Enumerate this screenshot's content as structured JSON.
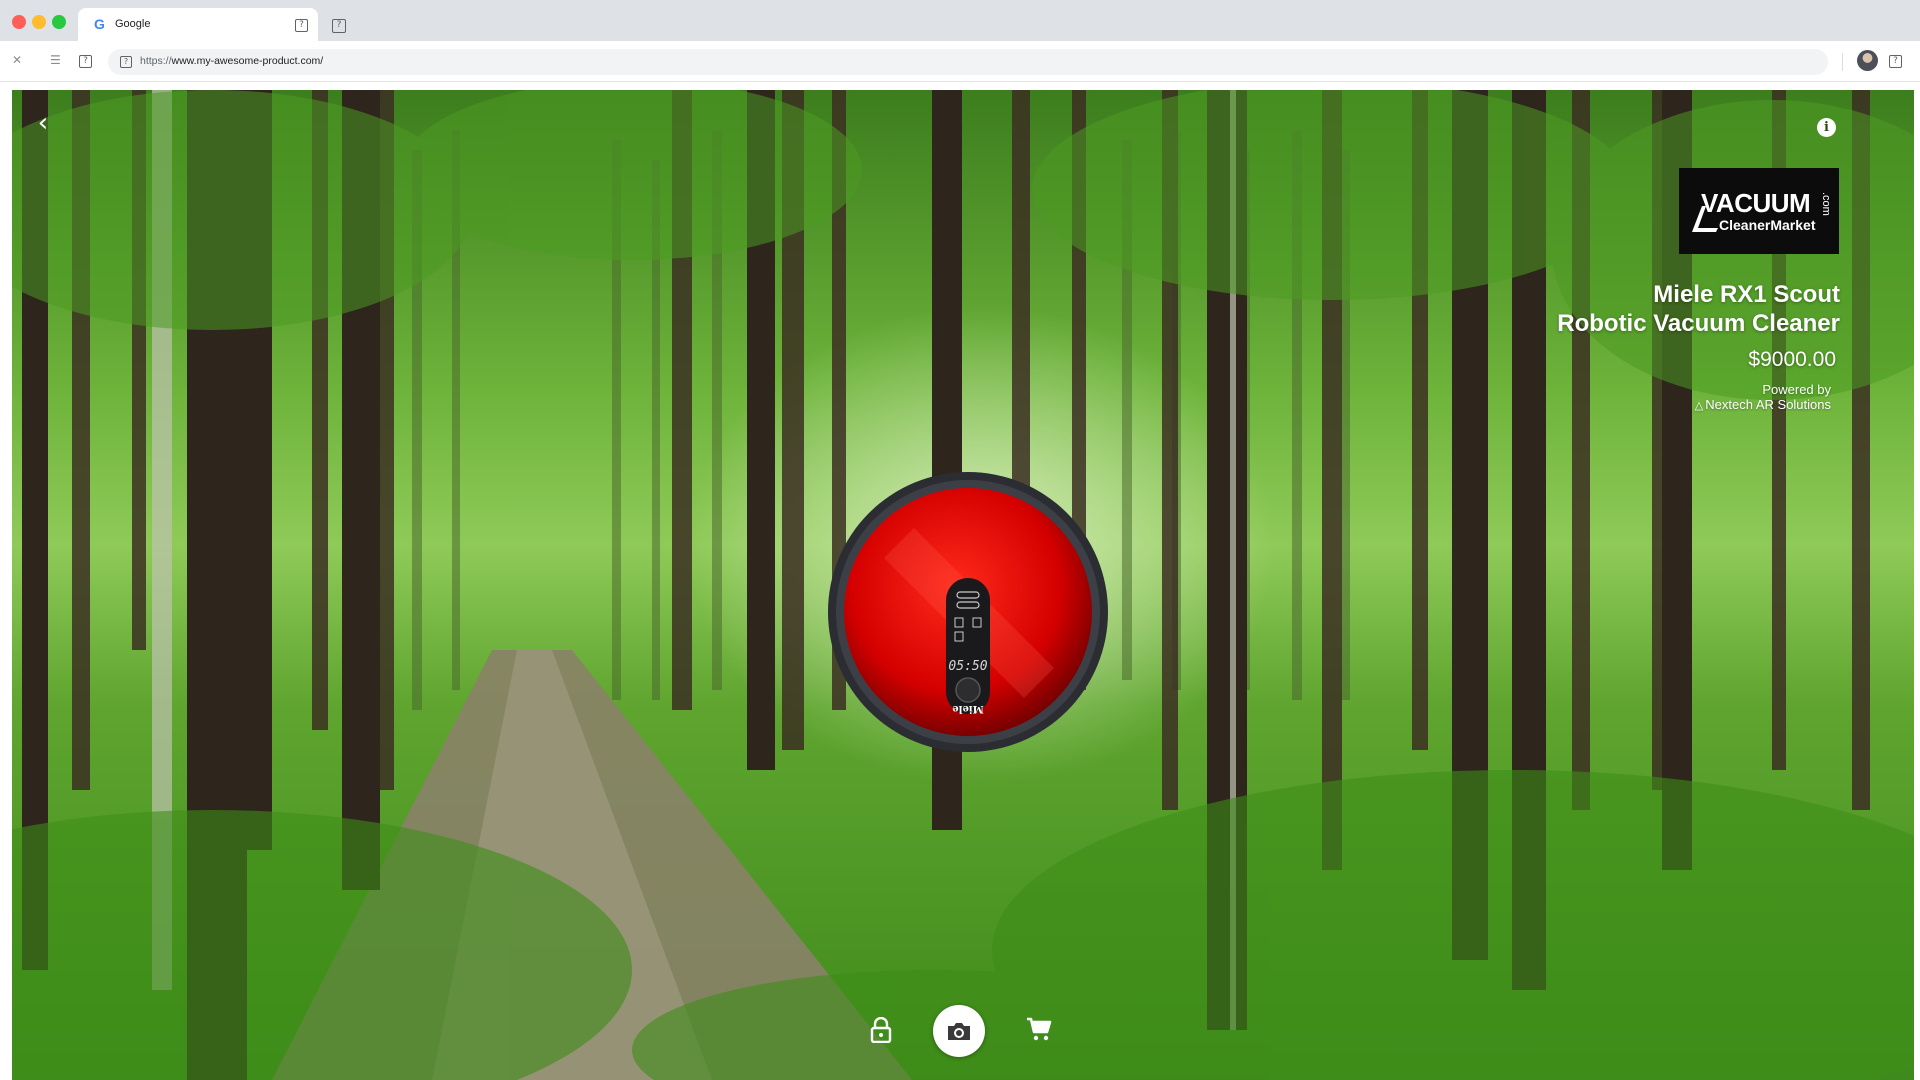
{
  "browser": {
    "tab": {
      "title": "Google",
      "favicon": "google-icon"
    },
    "address_bar": {
      "url_scheme": "https://",
      "url_host": "www.my-awesome-product.com/"
    }
  },
  "viewer": {
    "background": "forest-path-photo",
    "brand_logo": {
      "main": "VACUUM",
      "sub": "CleanerMarket",
      "suffix": ".com"
    },
    "product": {
      "name_line1": "Miele RX1 Scout",
      "name_line2": "Robotic Vacuum Cleaner",
      "price": "$9000.00"
    },
    "powered_by": {
      "label": "Powered by",
      "company": "Nextech AR Solutions"
    },
    "model": {
      "name": "robotic-vacuum-3d-model",
      "body_color": "#d40000",
      "display_time": "05:50",
      "badge": "Miele"
    },
    "controls": [
      "lock-icon",
      "camera-icon",
      "cart-icon"
    ]
  }
}
